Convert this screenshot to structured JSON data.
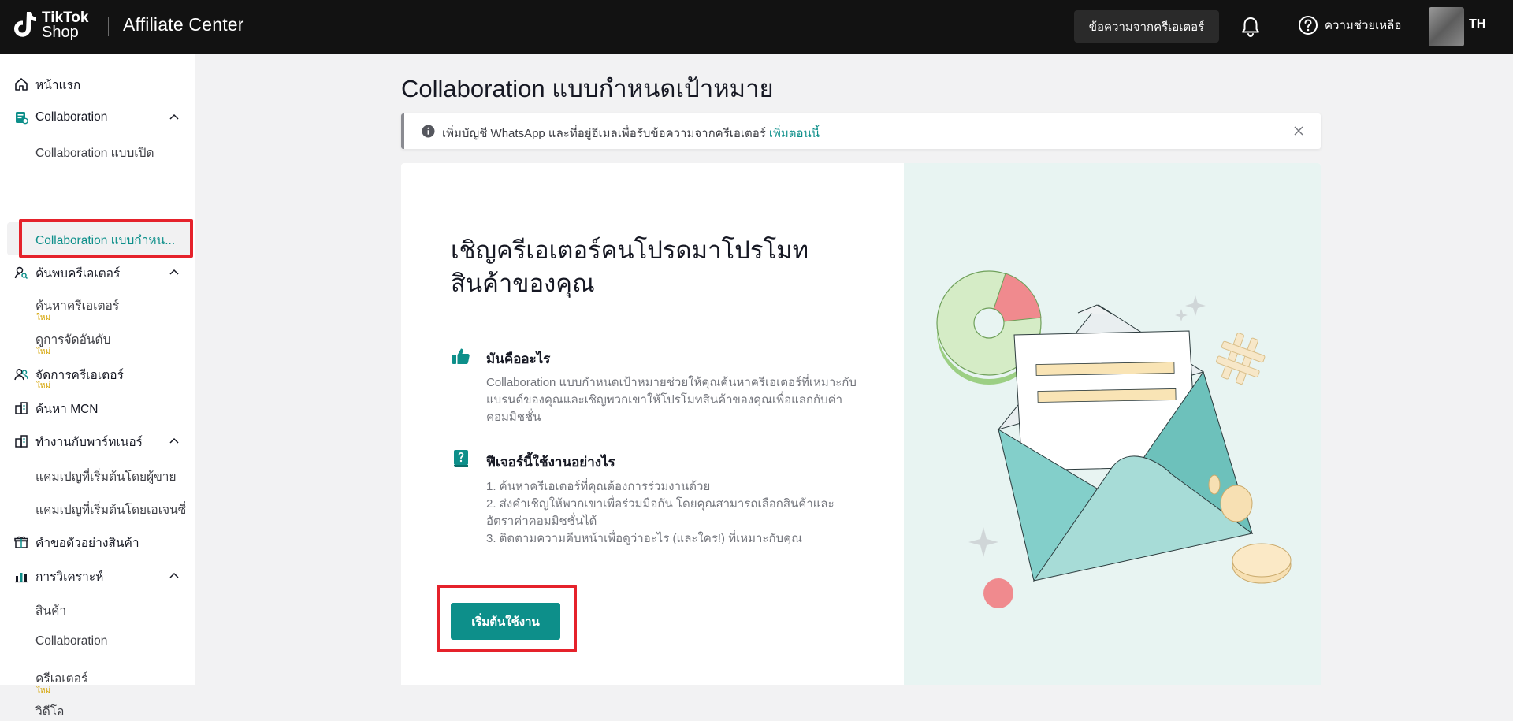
{
  "header": {
    "logo_line1": "TikTok",
    "logo_line2": "Shop",
    "app_title": "Affiliate Center",
    "creator_messages_label": "ข้อความจากครีเอเตอร์",
    "help_label": "ความช่วยเหลือ",
    "language_label": "TH"
  },
  "sidebar": {
    "home": "หน้าแรก",
    "collaboration": "Collaboration",
    "open_collab": "Collaboration แบบเปิด",
    "targeted_collab": "Collaboration แบบกำหน...",
    "discover_creators": "ค้นพบครีเอเตอร์",
    "find_creators": "ค้นหาครีเอเตอร์",
    "view_rankings": "ดูการจัดอันดับ",
    "manage_creators": "จัดการครีเอเตอร์",
    "find_mcn": "ค้นหา MCN",
    "partner_work": "ทำงานกับพาร์ทเนอร์",
    "seller_campaigns": "แคมเปญที่เริ่มต้นโดยผู้ขาย",
    "agency_campaigns": "แคมเปญที่เริ่มต้นโดยเอเจนซี่",
    "sample_requests": "คำขอตัวอย่างสินค้า",
    "analytics": "การวิเคราะห์",
    "analytics_products": "สินค้า",
    "analytics_collab": "Collaboration",
    "analytics_creators": "ครีเอเตอร์",
    "analytics_videos": "วิดีโอ",
    "new_badge": "ใหม่"
  },
  "main": {
    "page_title": "Collaboration แบบกำหนดเป้าหมาย",
    "alert_text": "เพิ่มบัญชี WhatsApp และที่อยู่อีเมลเพื่อรับข้อความจากครีเอเตอร์",
    "alert_link": "เพิ่มตอนนี้",
    "headline": "เชิญครีเอเตอร์คนโปรดมาโปรโมทสินค้าของคุณ",
    "what_title": "มันคืออะไร",
    "what_body": "Collaboration แบบกำหนดเป้าหมายช่วยให้คุณค้นหาครีเอเตอร์ที่เหมาะกับแบรนด์ของคุณและเชิญพวกเขาให้โปรโมทสินค้าของคุณเพื่อแลกกับค่าคอมมิชชั่น",
    "how_title": "ฟีเจอร์นี้ใช้งานอย่างไร",
    "step1": "1. ค้นหาครีเอเตอร์ที่คุณต้องการร่วมงานด้วย",
    "step2": "2. ส่งคำเชิญให้พวกเขาเพื่อร่วมมือกัน โดยคุณสามารถเลือกสินค้าและอัตราค่าคอมมิชชั่นได้",
    "step3": "3. ติดตามความคืบหน้าเพื่อดูว่าอะไร (และใคร!) ที่เหมาะกับคุณ",
    "start_button": "เริ่มต้นใช้งาน"
  },
  "colors": {
    "accent": "#0d8f8a",
    "highlight_border": "#e5222b",
    "topbar": "#121212",
    "new_badge": "#d4a300"
  }
}
